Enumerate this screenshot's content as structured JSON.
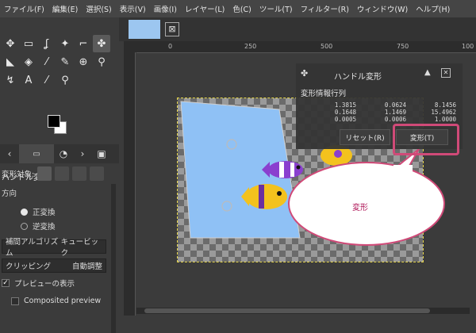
{
  "menu": [
    "ファイル(F)",
    "編集(E)",
    "選択(S)",
    "表示(V)",
    "画像(I)",
    "レイヤー(L)",
    "色(C)",
    "ツール(T)",
    "フィルター(R)",
    "ウィンドウ(W)",
    "ヘルプ(H)"
  ],
  "toolbox": {
    "tools": [
      "move-icon",
      "rect-select-icon",
      "lasso-icon",
      "fuzzy-select-icon",
      "crop-icon",
      "handle-transform-icon",
      "bucket-fill-icon",
      "paint-icon",
      "brush-icon",
      "eraser-icon",
      "clone-icon",
      "smudge-icon",
      "path-icon",
      "text-icon",
      "color-picker-icon",
      "zoom-icon"
    ],
    "tool_glyphs": [
      "✥",
      "▭",
      "ʆ",
      "✦",
      "⌐",
      "✤",
      "◣",
      "◈",
      "⁄",
      "✎",
      "⊕",
      "⚲",
      "↯",
      "A",
      "⁄",
      "⚲"
    ],
    "options": {
      "title": "ハンドル変形",
      "transform_target_label": "変形対象:",
      "direction_label": "方向",
      "direction_forward": "正変換",
      "direction_backward": "逆変換",
      "interpolation_label": "補間アルゴリズム",
      "interpolation_value": "キュービック",
      "clipping_label": "クリッピング",
      "clipping_value": "自動調整",
      "show_preview": "プレビューの表示",
      "composited_preview": "Composited preview"
    }
  },
  "ruler": {
    "top_labels": [
      "0",
      "250",
      "500",
      "750",
      "100"
    ]
  },
  "dialog": {
    "title": "ハンドル変形",
    "matrix_label": "変形情報行列",
    "matrix": [
      [
        "1.3815",
        "0.0624",
        "8.1456"
      ],
      [
        "0.1648",
        "1.1469",
        "15.4962"
      ],
      [
        "0.0005",
        "0.0006",
        "1.0000"
      ]
    ],
    "reset_button": "リセット(R)",
    "transform_button": "変形(T)"
  },
  "callout": {
    "text": "変形"
  },
  "colors": {
    "accent": "#d04a78",
    "canvas_fill": "#8fc1f5"
  }
}
